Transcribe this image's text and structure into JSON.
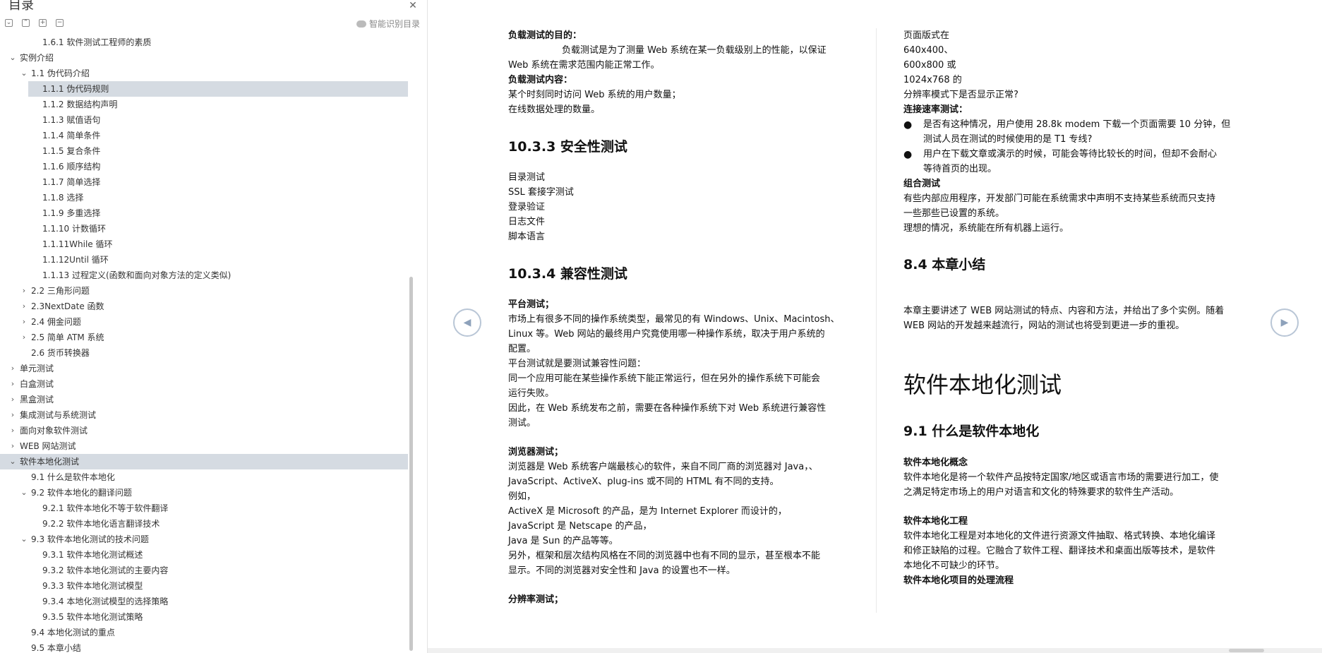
{
  "sidebar": {
    "title": "目录",
    "smart_toc_label": "智能识别目录",
    "toolbar": [
      "⌄",
      "⌃",
      "+",
      "−"
    ],
    "items": [
      {
        "label": "1.6.1 软件测试工程师的素质",
        "level": 2,
        "caret": ""
      },
      {
        "label": "实例介绍",
        "level": 0,
        "caret": "⌄"
      },
      {
        "label": "1.1 伪代码介绍",
        "level": 1,
        "caret": "⌄"
      },
      {
        "label": "1.1.1 伪代码规则",
        "level": 2,
        "caret": "",
        "selected": true
      },
      {
        "label": "1.1.2 数据结构声明",
        "level": 2,
        "caret": ""
      },
      {
        "label": "1.1.3 赋值语句",
        "level": 2,
        "caret": ""
      },
      {
        "label": "1.1.4 简单条件",
        "level": 2,
        "caret": ""
      },
      {
        "label": "1.1.5 复合条件",
        "level": 2,
        "caret": ""
      },
      {
        "label": "1.1.6 顺序结构",
        "level": 2,
        "caret": ""
      },
      {
        "label": "1.1.7 简单选择",
        "level": 2,
        "caret": ""
      },
      {
        "label": "1.1.8 选择",
        "level": 2,
        "caret": ""
      },
      {
        "label": "1.1.9 多重选择",
        "level": 2,
        "caret": ""
      },
      {
        "label": "1.1.10 计数循环",
        "level": 2,
        "caret": ""
      },
      {
        "label": "1.1.11While 循环",
        "level": 2,
        "caret": ""
      },
      {
        "label": "1.1.12Until 循环",
        "level": 2,
        "caret": ""
      },
      {
        "label": "1.1.13 过程定义(函数和面向对象方法的定义类似)",
        "level": 2,
        "caret": ""
      },
      {
        "label": "2.2 三角形问题",
        "level": 1,
        "caret": "›"
      },
      {
        "label": "2.3NextDate 函数",
        "level": 1,
        "caret": "›"
      },
      {
        "label": "2.4 佣金问题",
        "level": 1,
        "caret": "›"
      },
      {
        "label": "2.5 简单 ATM 系统",
        "level": 1,
        "caret": "›"
      },
      {
        "label": "2.6 货币转换器",
        "level": 1,
        "caret": ""
      },
      {
        "label": "单元测试",
        "level": 0,
        "caret": "›"
      },
      {
        "label": "白盒测试",
        "level": 0,
        "caret": "›"
      },
      {
        "label": "黑盒测试",
        "level": 0,
        "caret": "›"
      },
      {
        "label": "集成测试与系统测试",
        "level": 0,
        "caret": "›"
      },
      {
        "label": "面向对象软件测试",
        "level": 0,
        "caret": "›"
      },
      {
        "label": "WEB 网站测试",
        "level": 0,
        "caret": "›"
      },
      {
        "label": "软件本地化测试",
        "level": 0,
        "caret": "⌄",
        "selected": true
      },
      {
        "label": "9.1 什么是软件本地化",
        "level": 1,
        "caret": ""
      },
      {
        "label": "9.2 软件本地化的翻译问题",
        "level": 1,
        "caret": "⌄"
      },
      {
        "label": "9.2.1 软件本地化不等于软件翻译",
        "level": 2,
        "caret": ""
      },
      {
        "label": "9.2.2 软件本地化语言翻译技术",
        "level": 2,
        "caret": ""
      },
      {
        "label": "9.3 软件本地化测试的技术问题",
        "level": 1,
        "caret": "⌄"
      },
      {
        "label": "9.3.1 软件本地化测试概述",
        "level": 2,
        "caret": ""
      },
      {
        "label": "9.3.2 软件本地化测试的主要内容",
        "level": 2,
        "caret": ""
      },
      {
        "label": "9.3.3 软件本地化测试模型",
        "level": 2,
        "caret": ""
      },
      {
        "label": "9.3.4 本地化测试模型的选择策略",
        "level": 2,
        "caret": ""
      },
      {
        "label": "9.3.5 软件本地化测试策略",
        "level": 2,
        "caret": ""
      },
      {
        "label": "9.4 本地化测试的重点",
        "level": 1,
        "caret": ""
      },
      {
        "label": "9.5 本章小结",
        "level": 1,
        "caret": ""
      }
    ]
  },
  "nav": {
    "prev_icon": "◀",
    "next_icon": "▶"
  },
  "doc_left": {
    "load_goal_title": "负载测试的目的：",
    "load_goal_1": "负载测试是为了测量 Web 系统在某一负载级别上的性能，以保证",
    "load_goal_2": "Web 系统在需求范围内能正常工作。",
    "load_content_title": "负载测试内容：",
    "load_content_1": "某个时刻同时访问 Web 系统的用户数量；",
    "load_content_2": "在线数据处理的数量。",
    "sec_1033": "10.3.3  安全性测试",
    "sec_items": [
      "目录测试",
      "SSL 套接字测试",
      "登录验证",
      "日志文件",
      "脚本语言"
    ],
    "sec_1034": "10.3.4  兼容性测试",
    "platform_title": "平台测试；",
    "platform_1": "市场上有很多不同的操作系统类型，最常见的有 Windows、Unix、Macintosh、",
    "platform_2": "Linux 等。Web 网站的最终用户究竟使用哪一种操作系统，取决于用户系统的",
    "platform_3": "配置。",
    "platform_4": "平台测试就是要测试兼容性问题：",
    "platform_5": "同一个应用可能在某些操作系统下能正常运行，但在另外的操作系统下可能会",
    "platform_6": "运行失败。",
    "platform_7": "因此，在 Web 系统发布之前，需要在各种操作系统下对 Web 系统进行兼容性",
    "platform_8": "测试。",
    "browser_title": "浏览器测试；",
    "browser_1": "浏览器是 Web 系统客户端最核心的软件，来自不同厂商的浏览器对 Java，、",
    "browser_2": "JavaScript、ActiveX、plug-ins 或不同的 HTML 有不同的支持。",
    "browser_3": "例如，",
    "browser_4": "ActiveX 是 Microsoft 的产品，是为 Internet Explorer 而设计的，",
    "browser_5": "JavaScript 是 Netscape 的产品，",
    "browser_6": "Java 是 Sun 的产品等等。",
    "browser_7": "另外，框架和层次结构风格在不同的浏览器中也有不同的显示，甚至根本不能",
    "browser_8": "显示。不同的浏览器对安全性和 Java 的设置也不一样。",
    "resolution_title": "分辨率测试；"
  },
  "doc_right": {
    "res_1": "页面版式在",
    "res_2": "640x400、",
    "res_3": "600x800 或",
    "res_4": "1024x768 的",
    "res_5": "分辨率模式下是否显示正常?",
    "speed_title": "连接速率测试：",
    "bullet1_1": "是否有这种情况，用户使用 28.8k modem 下载一个页面需要 10 分钟，但",
    "bullet1_2": "测试人员在测试的时候使用的是 T1 专线?",
    "bullet2_1": "用户在下载文章或演示的时候，可能会等待比较长的时间，但却不会耐心",
    "bullet2_2": "等待首页的出现。",
    "combo_title": "组合测试",
    "combo_1": "有些内部应用程序，开发部门可能在系统需求中声明不支持某些系统而只支持",
    "combo_2": "一些那些已设置的系统。",
    "combo_3": "理想的情况，系统能在所有机器上运行。",
    "summary_heading": "8.4 本章小结",
    "summary_1": "本章主要讲述了 WEB 网站测试的特点、内容和方法，并给出了多个实例。随着",
    "summary_2": "WEB 网站的开发越来越流行，网站的测试也将受到更进一步的重视。",
    "chapter_title": "软件本地化测试",
    "sec_91": "9.1  什么是软件本地化",
    "concept_title": "软件本地化概念",
    "concept_1": "软件本地化是将一个软件产品按特定国家/地区或语言市场的需要进行加工，使",
    "concept_2": "之满足特定市场上的用户对语言和文化的特殊要求的软件生产活动。",
    "eng_title": "软件本地化工程",
    "eng_1": "软件本地化工程是对本地化的文件进行资源文件抽取、格式转换、本地化编译",
    "eng_2": "和修正缺陷的过程。它融合了软件工程、翻译技术和桌面出版等技术，是软件",
    "eng_3": "本地化不可缺少的环节。",
    "flow_title": "软件本地化项目的处理流程"
  }
}
